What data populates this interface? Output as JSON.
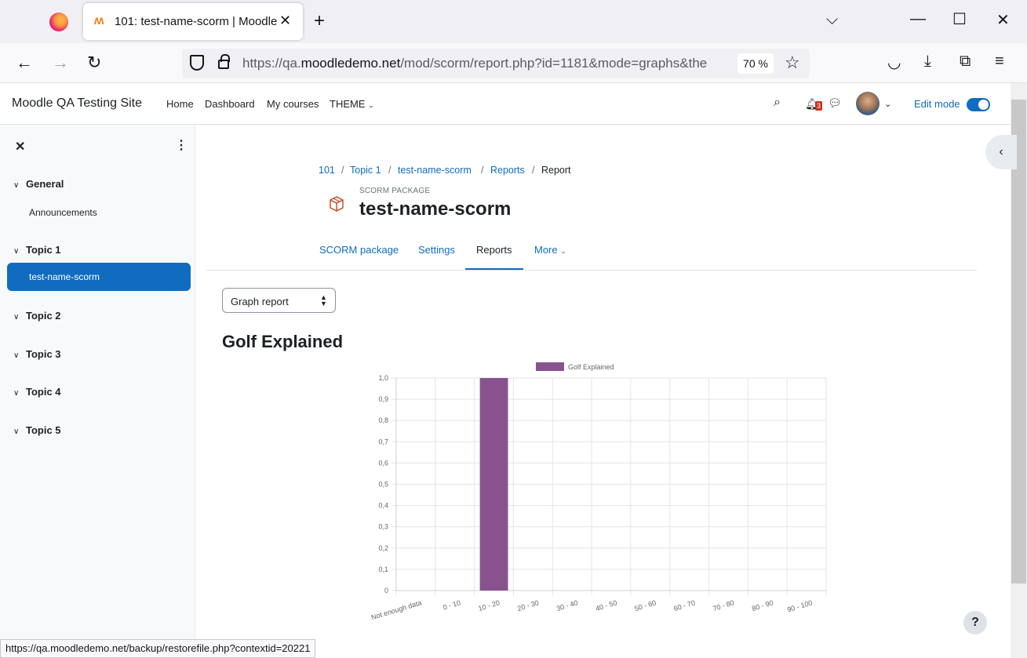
{
  "browser": {
    "tab_title": "101: test-name-scorm | Moodle",
    "url_prefix": "https://qa.",
    "url_host": "moodledemo.net",
    "url_rest": "/mod/scorm/report.php?id=1181&mode=graphs&the",
    "zoom": "70 %",
    "status_url": "https://qa.moodledemo.net/backup/restorefile.php?contextid=20221"
  },
  "navbar": {
    "site_name": "Moodle QA Testing Site",
    "links": [
      "Home",
      "Dashboard",
      "My courses",
      "THEME"
    ],
    "notification_count": "3",
    "edit_mode_label": "Edit mode"
  },
  "drawer": {
    "sections": [
      {
        "label": "General",
        "items": [
          "Announcements"
        ]
      },
      {
        "label": "Topic 1",
        "items": [
          "test-name-scorm"
        ]
      },
      {
        "label": "Topic 2",
        "items": []
      },
      {
        "label": "Topic 3",
        "items": []
      },
      {
        "label": "Topic 4",
        "items": []
      },
      {
        "label": "Topic 5",
        "items": []
      }
    ]
  },
  "breadcrumb": [
    "101",
    "Topic 1",
    "test-name-scorm",
    "Reports",
    "Report"
  ],
  "header": {
    "module_type": "SCORM PACKAGE",
    "title": "test-name-scorm"
  },
  "secondary_nav": [
    "SCORM package",
    "Settings",
    "Reports",
    "More"
  ],
  "report_select": {
    "value": "Graph report"
  },
  "report_title": "Golf Explained",
  "chart_data": {
    "type": "bar",
    "categories": [
      "Not enough data",
      "0 - 10",
      "10 - 20",
      "20 - 30",
      "30 - 40",
      "40 - 50",
      "50 - 60",
      "60 - 70",
      "70 - 80",
      "80 - 90",
      "90 - 100"
    ],
    "series": [
      {
        "name": "Golf Explained",
        "values": [
          0,
          0,
          1,
          0,
          0,
          0,
          0,
          0,
          0,
          0,
          0
        ],
        "color": "#88528f"
      }
    ],
    "ylim": [
      0,
      1
    ],
    "yticks": [
      "0",
      "0,1",
      "0,2",
      "0,3",
      "0,4",
      "0,5",
      "0,6",
      "0,7",
      "0,8",
      "0,9",
      "1,0"
    ],
    "grid": true,
    "legend": "top-center"
  }
}
